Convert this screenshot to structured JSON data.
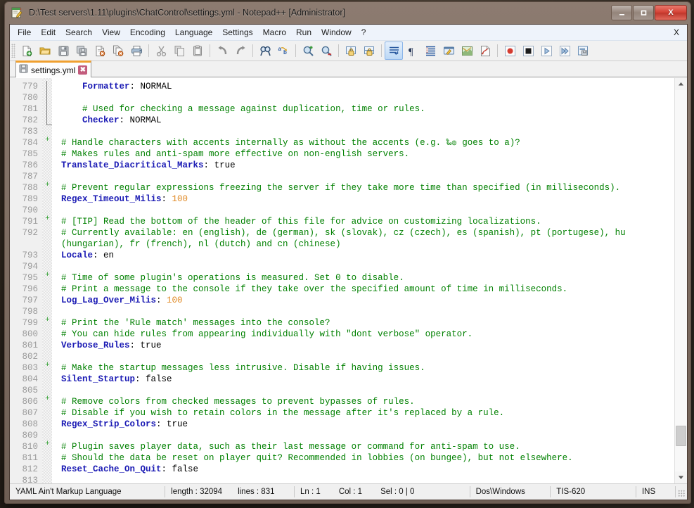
{
  "window": {
    "title": "D:\\Test servers\\1.11\\plugins\\ChatControl\\settings.yml - Notepad++ [Administrator]",
    "icon": "notepad-plus-plus-icon",
    "minimize_label": "—",
    "maximize_label": "▭",
    "close_label": "X",
    "accent_close": "#d64438",
    "tab_accent": "#f0a030"
  },
  "menubar": {
    "items": [
      {
        "label": "File"
      },
      {
        "label": "Edit"
      },
      {
        "label": "Search"
      },
      {
        "label": "View"
      },
      {
        "label": "Encoding"
      },
      {
        "label": "Language"
      },
      {
        "label": "Settings"
      },
      {
        "label": "Macro"
      },
      {
        "label": "Run"
      },
      {
        "label": "Window"
      },
      {
        "label": "?"
      }
    ],
    "close_doc_label": "X"
  },
  "toolbar": {
    "buttons": [
      {
        "name": "new-file-icon",
        "tip": "New"
      },
      {
        "name": "open-file-icon",
        "tip": "Open"
      },
      {
        "name": "save-icon",
        "tip": "Save"
      },
      {
        "name": "save-all-icon",
        "tip": "Save All"
      },
      {
        "name": "close-file-icon",
        "tip": "Close"
      },
      {
        "name": "close-all-files-icon",
        "tip": "Close All"
      },
      {
        "name": "print-icon",
        "tip": "Print"
      },
      {
        "name": "separator-1",
        "tip": ""
      },
      {
        "name": "cut-icon",
        "tip": "Cut"
      },
      {
        "name": "copy-icon",
        "tip": "Copy"
      },
      {
        "name": "paste-icon",
        "tip": "Paste"
      },
      {
        "name": "separator-2",
        "tip": ""
      },
      {
        "name": "undo-icon",
        "tip": "Undo"
      },
      {
        "name": "redo-icon",
        "tip": "Redo"
      },
      {
        "name": "separator-3",
        "tip": ""
      },
      {
        "name": "find-icon",
        "tip": "Find"
      },
      {
        "name": "replace-icon",
        "tip": "Replace"
      },
      {
        "name": "separator-4",
        "tip": ""
      },
      {
        "name": "zoom-in-icon",
        "tip": "Zoom In"
      },
      {
        "name": "zoom-out-icon",
        "tip": "Zoom Out"
      },
      {
        "name": "separator-5",
        "tip": ""
      },
      {
        "name": "sync-vertical-scroll-icon",
        "tip": "Synchronize Vertical Scrolling"
      },
      {
        "name": "sync-horizontal-scroll-icon",
        "tip": "Synchronize Horizontal Scrolling"
      },
      {
        "name": "separator-6",
        "tip": ""
      },
      {
        "name": "word-wrap-icon",
        "tip": "Word wrap"
      },
      {
        "name": "show-all-characters-icon",
        "tip": "Show All Characters"
      },
      {
        "name": "show-indent-guide-icon",
        "tip": "Show Indent Guide"
      },
      {
        "name": "user-defined-dialog-icon",
        "tip": "User Defined Dialogue"
      },
      {
        "name": "document-map-icon",
        "tip": "Document Map"
      },
      {
        "name": "function-list-icon",
        "tip": "Function List"
      },
      {
        "name": "separator-7",
        "tip": ""
      },
      {
        "name": "record-macro-icon",
        "tip": "Start Recording"
      },
      {
        "name": "stop-macro-icon",
        "tip": "Stop Recording"
      },
      {
        "name": "play-macro-icon",
        "tip": "Playback"
      },
      {
        "name": "run-macro-multiple-icon",
        "tip": "Run a Macro Multiple Times"
      },
      {
        "name": "save-macro-icon",
        "tip": "Save Current Recorded Macro"
      }
    ]
  },
  "tabs": [
    {
      "label": "settings.yml",
      "close": "✖",
      "icon": "saved-document-icon",
      "active": true
    }
  ],
  "editor": {
    "first_line": 779,
    "lines": [
      {
        "n": "779",
        "segs": [
          {
            "t": "    ",
            "c": "plain"
          },
          {
            "t": "Formatter",
            "c": "key"
          },
          {
            "t": ": ",
            "c": "plain"
          },
          {
            "t": "NORMAL",
            "c": "val"
          }
        ]
      },
      {
        "n": "780",
        "segs": []
      },
      {
        "n": "781",
        "segs": [
          {
            "t": "    # Used for checking a message against duplication, time or rules.",
            "c": "comment"
          }
        ]
      },
      {
        "n": "782",
        "segs": [
          {
            "t": "    ",
            "c": "plain"
          },
          {
            "t": "Checker",
            "c": "key"
          },
          {
            "t": ": ",
            "c": "plain"
          },
          {
            "t": "NORMAL",
            "c": "val"
          }
        ]
      },
      {
        "n": "783",
        "segs": []
      },
      {
        "n": "784",
        "segs": [
          {
            "t": "# Handle characters with accents internally as without the accents (e.g. ‰๏ goes to a)?",
            "c": "comment"
          }
        ]
      },
      {
        "n": "785",
        "segs": [
          {
            "t": "# Makes rules and anti-spam more effective on non-english servers.",
            "c": "comment"
          }
        ]
      },
      {
        "n": "786",
        "segs": [
          {
            "t": "Translate_Diacritical_Marks",
            "c": "key"
          },
          {
            "t": ": ",
            "c": "plain"
          },
          {
            "t": "true",
            "c": "val"
          }
        ]
      },
      {
        "n": "787",
        "segs": []
      },
      {
        "n": "788",
        "segs": [
          {
            "t": "# Prevent regular expressions freezing the server if they take more time than specified (in milliseconds).",
            "c": "comment"
          }
        ]
      },
      {
        "n": "789",
        "segs": [
          {
            "t": "Regex_Timeout_Milis",
            "c": "key"
          },
          {
            "t": ": ",
            "c": "plain"
          },
          {
            "t": "100",
            "c": "num"
          }
        ]
      },
      {
        "n": "790",
        "segs": []
      },
      {
        "n": "791",
        "segs": [
          {
            "t": "# [TIP] Read the bottom of the header of this file for advice on customizing localizations.",
            "c": "comment"
          }
        ]
      },
      {
        "n": "792",
        "segs": [
          {
            "t": "# Currently available: en (english), de (german), sk (slovak), cz (czech), es (spanish), pt (portugese), hu",
            "c": "comment"
          }
        ]
      },
      {
        "n": "",
        "segs": [
          {
            "t": "(hungarian), fr (french), nl (dutch) and cn (chinese)",
            "c": "comment"
          }
        ],
        "wrapped": true
      },
      {
        "n": "793",
        "segs": [
          {
            "t": "Locale",
            "c": "key"
          },
          {
            "t": ": ",
            "c": "plain"
          },
          {
            "t": "en",
            "c": "val"
          }
        ]
      },
      {
        "n": "794",
        "segs": []
      },
      {
        "n": "795",
        "segs": [
          {
            "t": "# Time of some plugin's operations is measured. Set 0 to disable.",
            "c": "comment"
          }
        ]
      },
      {
        "n": "796",
        "segs": [
          {
            "t": "# Print a message to the console if they take over the specified amount of time in milliseconds.",
            "c": "comment"
          }
        ]
      },
      {
        "n": "797",
        "segs": [
          {
            "t": "Log_Lag_Over_Milis",
            "c": "key"
          },
          {
            "t": ": ",
            "c": "plain"
          },
          {
            "t": "100",
            "c": "num"
          }
        ]
      },
      {
        "n": "798",
        "segs": []
      },
      {
        "n": "799",
        "segs": [
          {
            "t": "# Print the 'Rule match' messages into the console?",
            "c": "comment"
          }
        ]
      },
      {
        "n": "800",
        "segs": [
          {
            "t": "# You can hide rules from appearing individually with \"dont verbose\" operator.",
            "c": "comment"
          }
        ]
      },
      {
        "n": "801",
        "segs": [
          {
            "t": "Verbose_Rules",
            "c": "key"
          },
          {
            "t": ": ",
            "c": "plain"
          },
          {
            "t": "true",
            "c": "val"
          }
        ]
      },
      {
        "n": "802",
        "segs": []
      },
      {
        "n": "803",
        "segs": [
          {
            "t": "# Make the startup messages less intrusive. Disable if having issues.",
            "c": "comment"
          }
        ]
      },
      {
        "n": "804",
        "segs": [
          {
            "t": "Silent_Startup",
            "c": "key"
          },
          {
            "t": ": ",
            "c": "plain"
          },
          {
            "t": "false",
            "c": "val"
          }
        ]
      },
      {
        "n": "805",
        "segs": []
      },
      {
        "n": "806",
        "segs": [
          {
            "t": "# Remove colors from checked messages to prevent bypasses of rules.",
            "c": "comment"
          }
        ]
      },
      {
        "n": "807",
        "segs": [
          {
            "t": "# Disable if you wish to retain colors in the message after it's replaced by a rule.",
            "c": "comment"
          }
        ]
      },
      {
        "n": "808",
        "segs": [
          {
            "t": "Regex_Strip_Colors",
            "c": "key"
          },
          {
            "t": ": ",
            "c": "plain"
          },
          {
            "t": "true",
            "c": "val"
          }
        ]
      },
      {
        "n": "809",
        "segs": []
      },
      {
        "n": "810",
        "segs": [
          {
            "t": "# Plugin saves player data, such as their last message or command for anti-spam to use.",
            "c": "comment"
          }
        ]
      },
      {
        "n": "811",
        "segs": [
          {
            "t": "# Should the data be reset on player quit? Recommended in lobbies (on bungee), but not elsewhere.",
            "c": "comment"
          }
        ]
      },
      {
        "n": "812",
        "segs": [
          {
            "t": "Reset_Cache_On_Quit",
            "c": "key"
          },
          {
            "t": ": ",
            "c": "plain"
          },
          {
            "t": "false",
            "c": "val"
          }
        ]
      },
      {
        "n": "813",
        "segs": []
      }
    ],
    "colors": {
      "comment": "#008000",
      "key": "#1a1ab4",
      "value": "#000000",
      "number": "#e08a26",
      "linenumber": "#9a9a9a",
      "background": "#ffffff"
    }
  },
  "scrollbar": {
    "up_arrow": "▲",
    "down_arrow": "▼",
    "thumb_position_percent": 88
  },
  "statusbar": {
    "language": "YAML Ain't Markup Language",
    "length_label": "length : 32094",
    "lines_label": "lines : 831",
    "ln": "Ln : 1",
    "col": "Col : 1",
    "sel": "Sel : 0 | 0",
    "eol": "Dos\\Windows",
    "encoding": "TIS-620",
    "mode": "INS"
  }
}
